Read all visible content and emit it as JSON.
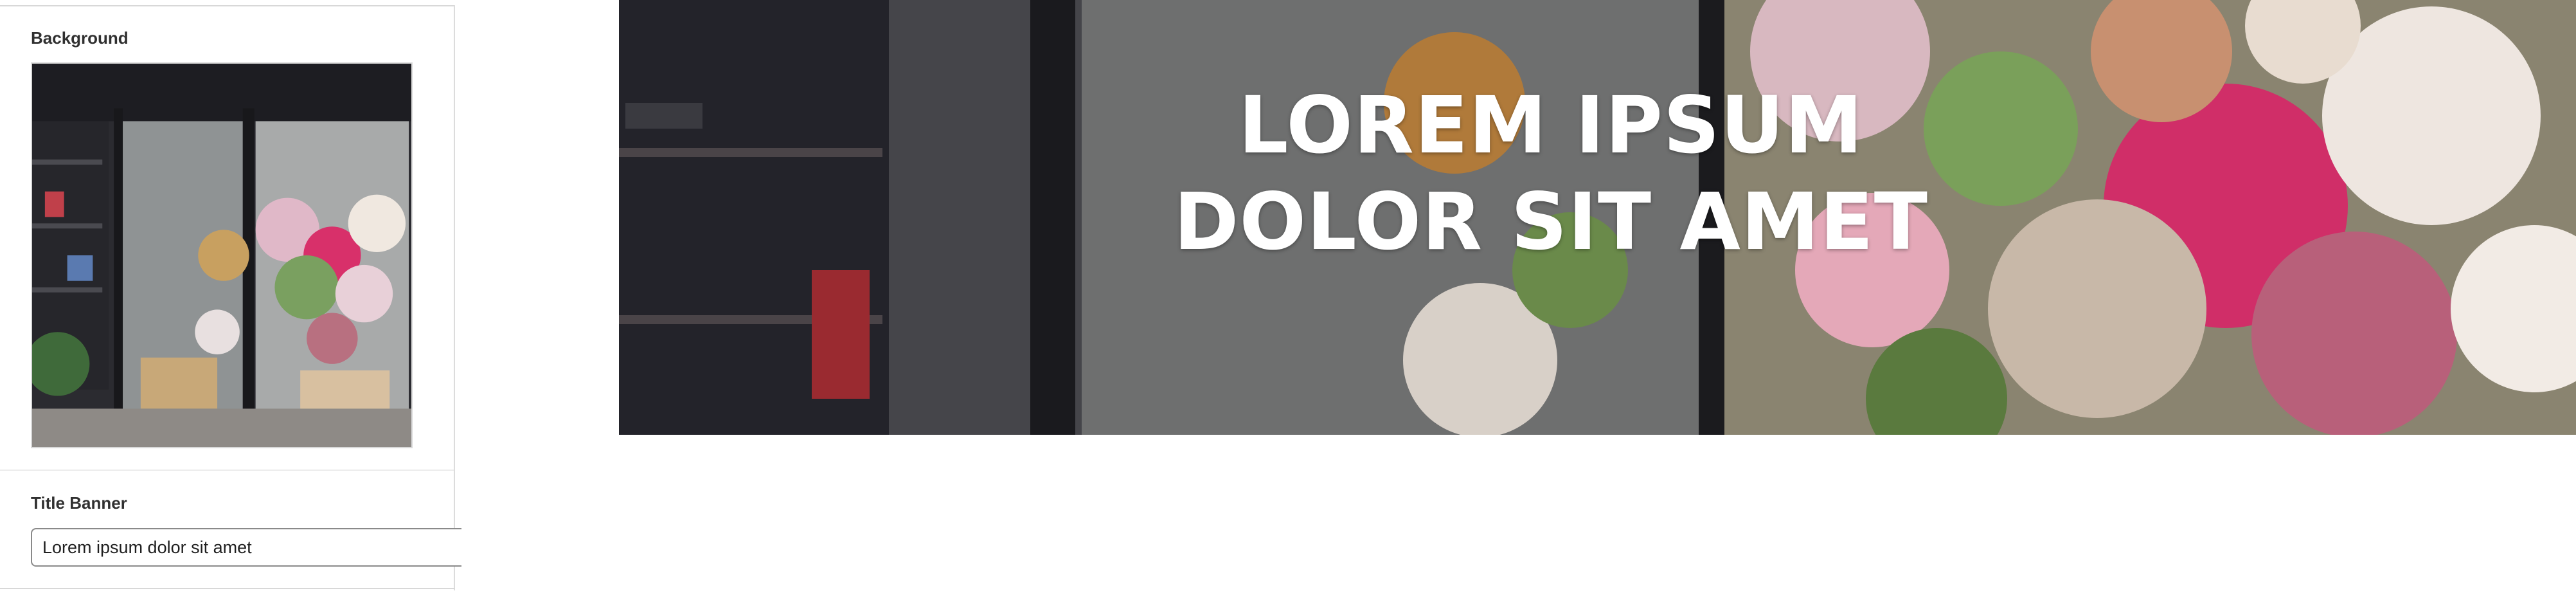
{
  "panel": {
    "background_label": "Background",
    "title_banner_label": "Title Banner",
    "title_input_value": "Lorem ipsum dolor sit amet"
  },
  "banner": {
    "title": "LOREM IPSUM DOLOR SIT AMET"
  },
  "colors": {
    "panel_border": "#d8d8d8",
    "banner_text": "#ffffff",
    "flower_pink": "#d8306a"
  }
}
